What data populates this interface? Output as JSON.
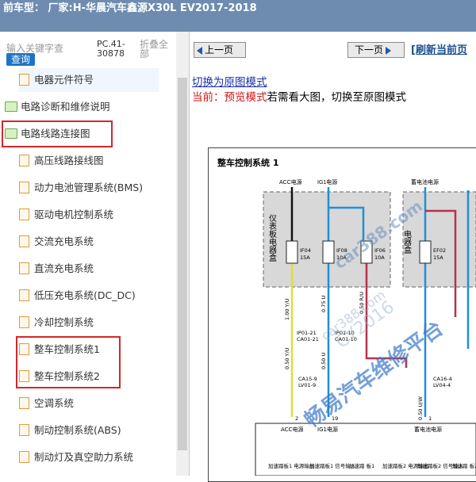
{
  "header": {
    "title": "前车型：  厂家:H-华晨汽车鑫源X30L EV2017-2018"
  },
  "sidebar": {
    "search_placeholder": "输入关键字查",
    "search_button": "查询",
    "pc_code": "PC.41-30878",
    "collapse_all": "折叠全部",
    "items": [
      {
        "label": "电器元件符号"
      },
      {
        "label": "电路诊断和维修说明"
      },
      {
        "label": "电路线路连接图"
      },
      {
        "label": "高压线路接线图"
      },
      {
        "label": "动力电池管理系统(BMS)"
      },
      {
        "label": "驱动电机控制系统"
      },
      {
        "label": "交流充电系统"
      },
      {
        "label": "直流充电系统"
      },
      {
        "label": "低压充电系统(DC_DC)"
      },
      {
        "label": "冷却控制系统"
      },
      {
        "label": "整车控制系统1"
      },
      {
        "label": "整车控制系统2"
      },
      {
        "label": "空调系统"
      },
      {
        "label": "制动控制系统(ABS)"
      },
      {
        "label": "制动灯及真空助力系统"
      }
    ]
  },
  "toolbar": {
    "prev_page": "上一页",
    "next_page": "下一页",
    "refresh": "[刷新当前页"
  },
  "content": {
    "switch_link": "切换为原图模式",
    "mode_current": "当前：",
    "mode_preview": "预览模式",
    "mode_hint": "若需看大图，切换至原图模式"
  },
  "diagram": {
    "title": "整车控制系统 1",
    "acc_power": "ACC电源",
    "ig1_power": "IG1电源",
    "battery_power": "蓄电池电源",
    "fuse_box_left": "仪表板电器盒",
    "fuse_box_right": "电器盒",
    "fuses": [
      {
        "id": "IF04",
        "rating": "15A"
      },
      {
        "id": "IF08",
        "rating": "10A"
      },
      {
        "id": "IF06",
        "rating": "10A"
      },
      {
        "id": "EF02",
        "rating": "15A"
      }
    ],
    "wires": [
      "1.00 Y/U",
      "0.75 U",
      "0.50 R/U",
      "0.50 Y/U",
      "0.50 U",
      "0.50 U/W"
    ],
    "connectors": [
      {
        "top": "IP01-21",
        "bottom": "CA01-21"
      },
      {
        "top": "IP01-10",
        "bottom": "CA01-10"
      },
      {
        "top": "CA15-9",
        "bottom": "LV01-9"
      },
      {
        "top": "CA16-4",
        "bottom": "LV04-4"
      }
    ],
    "pins": [
      "2",
      "19",
      "1"
    ],
    "bottom_labels": [
      "ACC电源",
      "IG1电源",
      "蓄电池电源"
    ],
    "bottom_small": [
      "加速踏板1 电源输出",
      "加速踏板1 信号输入",
      "加速踏 板1",
      "加速踏板2 电源输出",
      "加速踏板2 信号输入",
      "加速踏 板2"
    ],
    "watermarks": [
      "car388.com",
      "car388.com",
      "CY2016",
      "畅易汽车维修平台"
    ]
  },
  "colors": {
    "topbar": "#6d8cb0",
    "highlight_box": "#d6262a",
    "wire_yellow": "#dede3c",
    "wire_blue": "#1f8fd6",
    "wire_red": "#b5324e",
    "watermark": "#3a78c8"
  }
}
